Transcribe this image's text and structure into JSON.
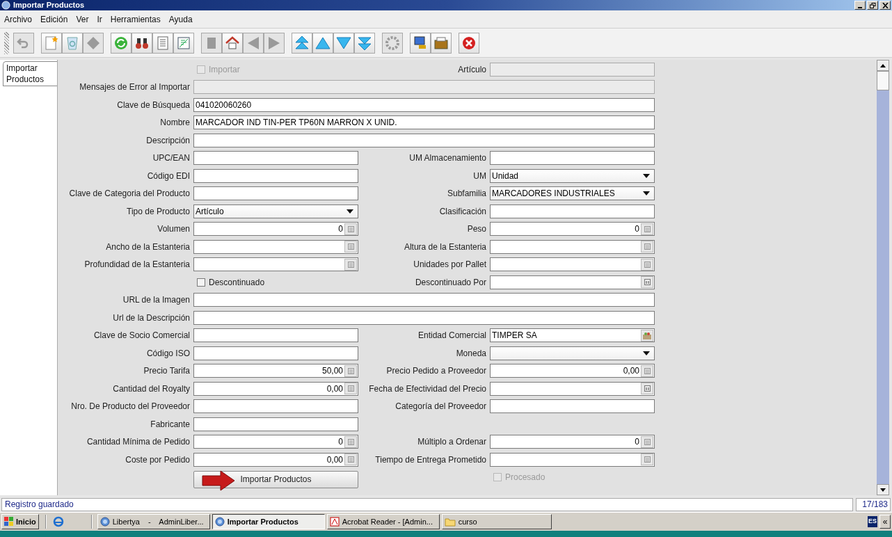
{
  "window": {
    "title": "Importar Productos"
  },
  "menu": [
    "Archivo",
    "Edición",
    "Ver",
    "Ir",
    "Herramientas",
    "Ayuda"
  ],
  "toolbar": [
    {
      "buttons": [
        {
          "kind": "undo",
          "disabled": true
        }
      ]
    },
    {
      "buttons": [
        {
          "kind": "new",
          "disabled": false
        },
        {
          "kind": "copy",
          "disabled": false
        },
        {
          "kind": "delete",
          "disabled": true
        }
      ]
    },
    {
      "buttons": [
        {
          "kind": "refresh",
          "disabled": false
        },
        {
          "kind": "find",
          "disabled": false
        },
        {
          "kind": "report",
          "disabled": false
        },
        {
          "kind": "grid",
          "disabled": false
        }
      ]
    },
    {
      "buttons": [
        {
          "kind": "attachment",
          "disabled": true
        },
        {
          "kind": "home",
          "disabled": false
        },
        {
          "kind": "back",
          "disabled": true
        },
        {
          "kind": "forward",
          "disabled": true
        }
      ]
    },
    {
      "buttons": [
        {
          "kind": "first",
          "disabled": false
        },
        {
          "kind": "previous",
          "disabled": false
        },
        {
          "kind": "next",
          "disabled": false
        },
        {
          "kind": "last",
          "disabled": false
        }
      ]
    },
    {
      "buttons": [
        {
          "kind": "workflow",
          "disabled": true
        }
      ]
    },
    {
      "buttons": [
        {
          "kind": "monitor",
          "disabled": false
        },
        {
          "kind": "archive",
          "disabled": false
        }
      ]
    },
    {
      "buttons": [
        {
          "kind": "exit",
          "disabled": false
        }
      ]
    }
  ],
  "tabs": [
    {
      "label": "Importar Productos",
      "selected": true
    }
  ],
  "form": {
    "rows": [
      {
        "kind": "pair",
        "left": {
          "kind": "checkbox",
          "label": "Importar",
          "checked": false,
          "disabled": true
        },
        "right": {
          "kind": "readonly",
          "label": "Artículo"
        }
      },
      {
        "kind": "full",
        "field": {
          "kind": "readonly",
          "label": "Mensajes de Error al Importar"
        }
      },
      {
        "kind": "full",
        "field": {
          "kind": "text",
          "label": "Clave de Búsqueda",
          "value": "041020060260"
        }
      },
      {
        "kind": "full",
        "field": {
          "kind": "text",
          "label": "Nombre",
          "value": "MARCADOR IND TIN-PER TP60N MARRON X UNID."
        }
      },
      {
        "kind": "full",
        "field": {
          "kind": "text",
          "label": "Descripción"
        }
      },
      {
        "kind": "pair",
        "left": {
          "kind": "text",
          "label": "UPC/EAN"
        },
        "right": {
          "kind": "text",
          "label": "UM Almacenamiento"
        }
      },
      {
        "kind": "pair",
        "left": {
          "kind": "text",
          "label": "Código EDI"
        },
        "right": {
          "kind": "combo",
          "label": "UM",
          "value": "Unidad"
        }
      },
      {
        "kind": "pair",
        "left": {
          "kind": "text",
          "label": "Clave de Categoria del Producto"
        },
        "right": {
          "kind": "combo",
          "label": "Subfamilia",
          "value": "MARCADORES INDUSTRIALES"
        }
      },
      {
        "kind": "pair",
        "left": {
          "kind": "combo",
          "label": "Tipo de Producto",
          "value": "Artículo"
        },
        "right": {
          "kind": "text",
          "label": "Clasificación"
        }
      },
      {
        "kind": "pair",
        "left": {
          "kind": "number",
          "label": "Volumen",
          "value": "0"
        },
        "right": {
          "kind": "number",
          "label": "Peso",
          "value": "0"
        }
      },
      {
        "kind": "pair",
        "left": {
          "kind": "number",
          "label": "Ancho de la Estanteria"
        },
        "right": {
          "kind": "number",
          "label": "Altura de la Estanteria"
        }
      },
      {
        "kind": "pair",
        "left": {
          "kind": "number",
          "label": "Profundidad de la Estanteria"
        },
        "right": {
          "kind": "number",
          "label": "Unidades por Pallet"
        }
      },
      {
        "kind": "pair",
        "left": {
          "kind": "checkbox",
          "label": "Descontinuado",
          "checked": false,
          "disabled": false
        },
        "right": {
          "kind": "date",
          "label": "Descontinuado Por"
        }
      },
      {
        "kind": "full",
        "field": {
          "kind": "text",
          "label": "URL de la Imagen"
        }
      },
      {
        "kind": "full",
        "field": {
          "kind": "text",
          "label": "Url de la Descripción"
        }
      },
      {
        "kind": "pair",
        "left": {
          "kind": "text",
          "label": "Clave de Socio Comercial"
        },
        "right": {
          "kind": "search",
          "label": "Entidad Comercial",
          "value": "TIMPER SA"
        }
      },
      {
        "kind": "pair",
        "left": {
          "kind": "text",
          "label": "Código ISO"
        },
        "right": {
          "kind": "combo",
          "label": "Moneda"
        }
      },
      {
        "kind": "pair",
        "left": {
          "kind": "number",
          "label": "Precio Tarifa",
          "value": "50,00"
        },
        "right": {
          "kind": "number",
          "label": "Precio Pedido a Proveedor",
          "value": "0,00"
        }
      },
      {
        "kind": "pair",
        "left": {
          "kind": "number",
          "label": "Cantidad del Royalty",
          "value": "0,00"
        },
        "right": {
          "kind": "date",
          "label": "Fecha de Efectividad del Precio"
        }
      },
      {
        "kind": "pair",
        "left": {
          "kind": "text",
          "label": "Nro. De Producto del Proveedor"
        },
        "right": {
          "kind": "text",
          "label": "Categoría del Proveedor"
        }
      },
      {
        "kind": "pair",
        "left": {
          "kind": "text",
          "label": "Fabricante"
        }
      },
      {
        "kind": "pair",
        "left": {
          "kind": "number",
          "label": "Cantidad Mínima de Pedido",
          "value": "0"
        },
        "right": {
          "kind": "number",
          "label": "Múltiplo a Ordenar",
          "value": "0"
        }
      },
      {
        "kind": "pair",
        "left": {
          "kind": "number",
          "label": "Coste por Pedido",
          "value": "0,00"
        },
        "right": {
          "kind": "number",
          "label": "Tiempo de Entrega Prometido"
        }
      },
      {
        "kind": "pair",
        "left": {
          "kind": "button",
          "label": "Importar Productos"
        },
        "right": {
          "kind": "checkbox",
          "label": "Procesado",
          "checked": false,
          "disabled": true
        }
      }
    ]
  },
  "status_bar": {
    "message": "Registro guardado",
    "record": "17/183"
  },
  "taskbar": {
    "start": "Inicio",
    "tasks": [
      {
        "label": "Libertya    -    AdminLiber...",
        "kind": "app",
        "selected": false
      },
      {
        "label": "Importar Productos",
        "kind": "app",
        "selected": true
      },
      {
        "label": "Acrobat Reader - [Admin...",
        "kind": "pdf",
        "selected": false
      },
      {
        "label": "curso",
        "kind": "folder",
        "selected": false
      }
    ],
    "language": "ES",
    "tray_toggle": "«"
  }
}
